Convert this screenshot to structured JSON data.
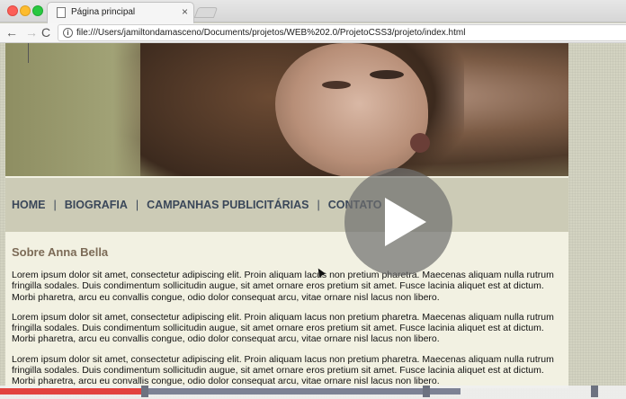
{
  "browser": {
    "tab_title": "Página principal",
    "tab_close": "×",
    "url": "file:///Users/jamiltondamasceno/Documents/projetos/WEB%202.0/ProjetoCSS3/projeto/index.html",
    "back": "←",
    "forward": "→",
    "reload": "C",
    "info": "i"
  },
  "nav": {
    "items": [
      "HOME",
      "BIOGRAFIA",
      "CAMPANHAS PUBLICITÁRIAS",
      "CONTATO"
    ],
    "separator": "|"
  },
  "content": {
    "title": "Sobre Anna Bella",
    "paragraphs": [
      "Lorem ipsum dolor sit amet, consectetur adipiscing elit. Proin aliquam lacus non pretium pharetra. Maecenas aliquam nulla rutrum fringilla sodales. Duis condimentum sollicitudin augue, sit amet ornare eros pretium sit amet. Fusce lacinia aliquet est at dictum. Morbi pharetra, arcu eu convallis congue, odio dolor consequat arcu, vitae ornare nisl lacus non libero.",
      "Lorem ipsum dolor sit amet, consectetur adipiscing elit. Proin aliquam lacus non pretium pharetra. Maecenas aliquam nulla rutrum fringilla sodales. Duis condimentum sollicitudin augue, sit amet ornare eros pretium sit amet. Fusce lacinia aliquet est at dictum. Morbi pharetra, arcu eu convallis congue, odio dolor consequat arcu, vitae ornare nisl lacus non libero.",
      "Lorem ipsum dolor sit amet, consectetur adipiscing elit. Proin aliquam lacus non pretium pharetra. Maecenas aliquam nulla rutrum fringilla sodales. Duis condimentum sollicitudin augue, sit amet ornare eros pretium sit amet. Fusce lacinia aliquet est at dictum. Morbi pharetra, arcu eu convallis congue, odio dolor consequat arcu, vitae ornare nisl lacus non libero."
    ]
  },
  "video": {
    "played_fraction": 0.227,
    "buffered_fraction": 0.736
  },
  "icons": {
    "play": "play-icon",
    "info": "info-icon"
  },
  "colors": {
    "nav_text": "#3a4759",
    "section_title": "#7c6b57",
    "progress_played": "#e2433f"
  }
}
